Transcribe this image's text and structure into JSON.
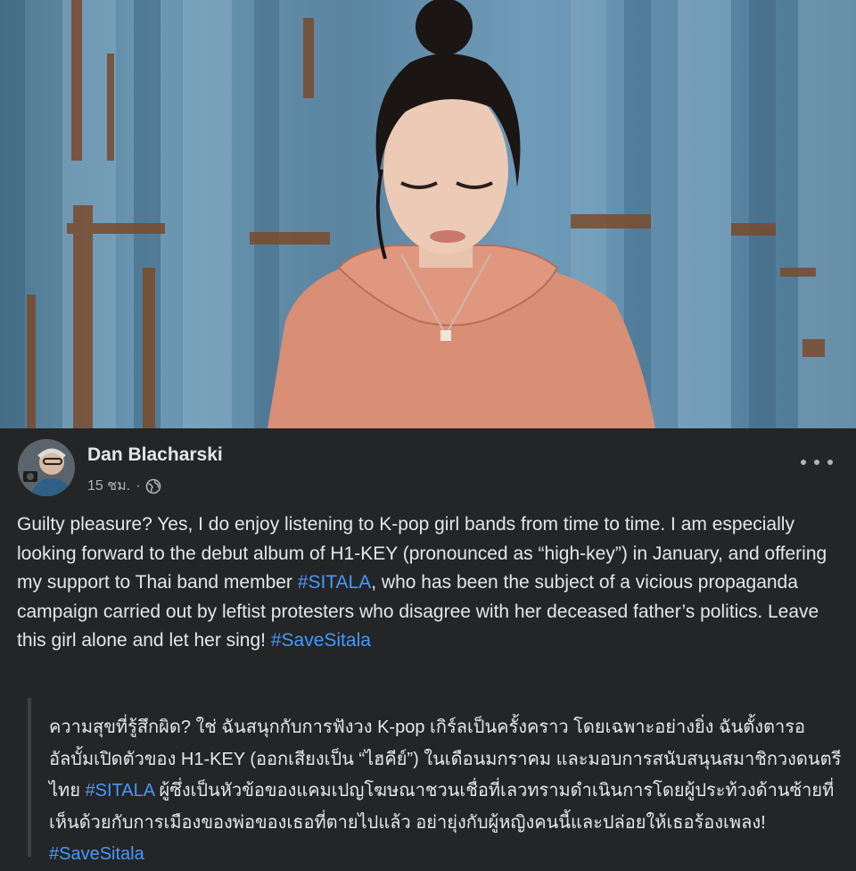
{
  "post": {
    "author": "Dan Blacharski",
    "time": "15 ชม.",
    "separator": "·",
    "privacy_icon": "globe-icon",
    "more_icon": "more-horizontal-icon",
    "body": {
      "segments": [
        "Guilty pleasure? Yes, I do enjoy listening to K-pop girl bands from time to time. I am especially looking forward to the debut album of H1-KEY (pronounced as “high-key”) in January, and offering my support to Thai band member ",
        "#SITALA",
        ", who has been the subject of a vicious propaganda campaign carried out by leftist protesters who disagree with her deceased father’s politics. Leave this girl alone and let her sing! ",
        "#SaveSitala"
      ]
    },
    "translation": {
      "segments": [
        "ความสุขที่รู้สึกผิด? ใช่ ฉันสนุกกับการฟังวง K-pop เกิร์ลเป็นครั้งคราว โดยเฉพาะอย่างยิ่ง ฉันตั้งตารออัลบั้มเปิดตัวของ H1-KEY (ออกเสียงเป็น “ไฮคีย์”) ในเดือนมกราคม และมอบการสนับสนุนสมาชิกวงดนตรีไทย ",
        "#SITALA",
        " ผู้ซึ่งเป็นหัวข้อของแคมเปญโฆษณาชวนเชื่อที่เลวทรามดำเนินการโดยผู้ประท้วงด้านซ้ายที่ เห็นด้วยกับการเมืองของพ่อของเธอที่ตายไปแล้ว อย่ายุ่งกับผู้หญิงคนนี้และปล่อยให้เธอร้องเพลง! ",
        "#SaveSitala"
      ]
    }
  },
  "colors": {
    "background": "#242526",
    "text": "#e4e6eb",
    "secondary_text": "#b0b3b8",
    "hashtag": "#4599ff",
    "quote_border": "#3e4042",
    "container_wall": "#6c98b4",
    "blouse": "#d98e76"
  }
}
